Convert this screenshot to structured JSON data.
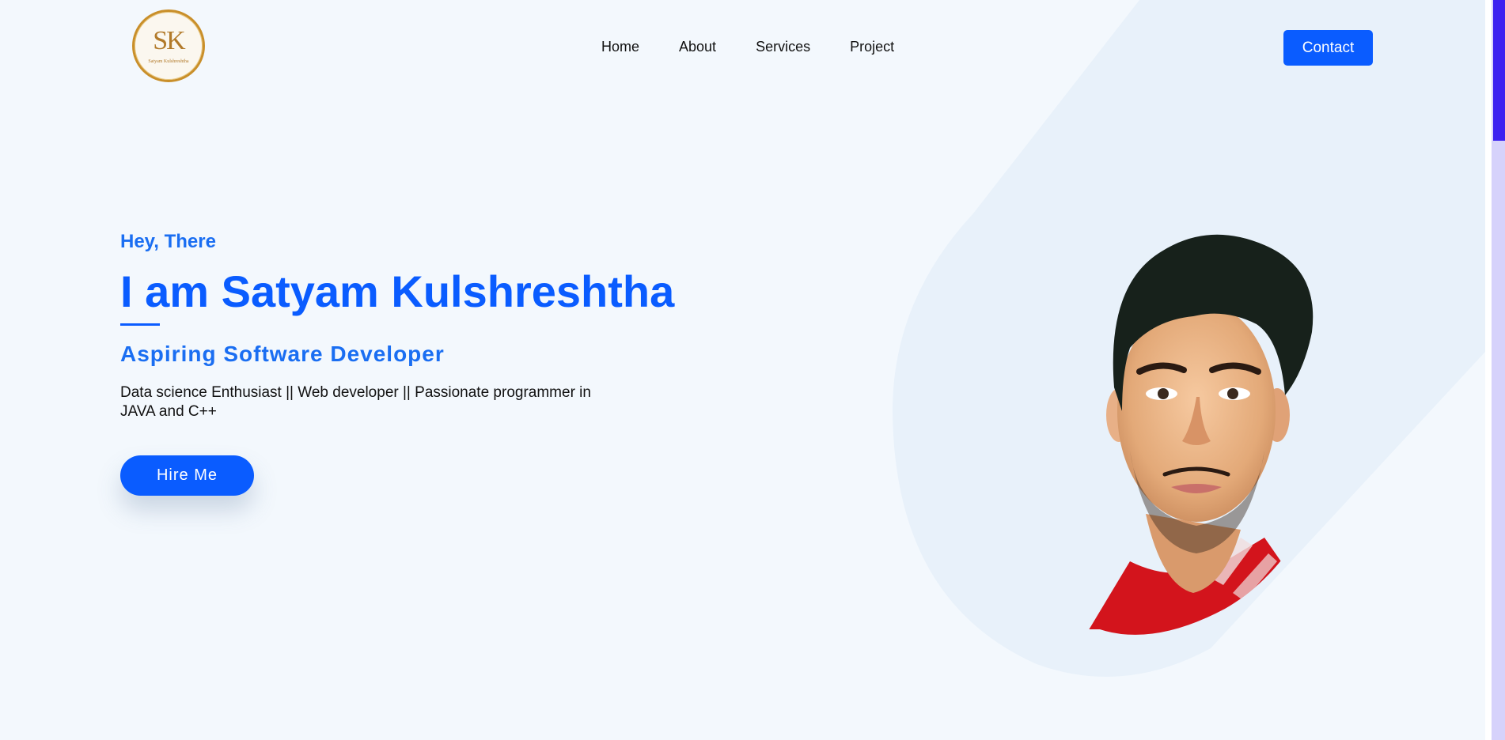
{
  "logo": {
    "mark": "SK",
    "subtitle": "Satyam Kulshreshtha"
  },
  "nav": {
    "items": [
      "Home",
      "About",
      "Services",
      "Project"
    ],
    "contact_label": "Contact"
  },
  "hero": {
    "greeting": "Hey, There",
    "headline": "I am Satyam Kulshreshtha",
    "role": "Aspiring Software Developer",
    "description": "Data science Enthusiast || Web developer || Passionate programmer in JAVA and C++",
    "cta_label": "Hire Me"
  },
  "colors": {
    "accent": "#0a5cff",
    "background": "#f3f8fd",
    "scroll_thumb": "#3c21f0"
  }
}
